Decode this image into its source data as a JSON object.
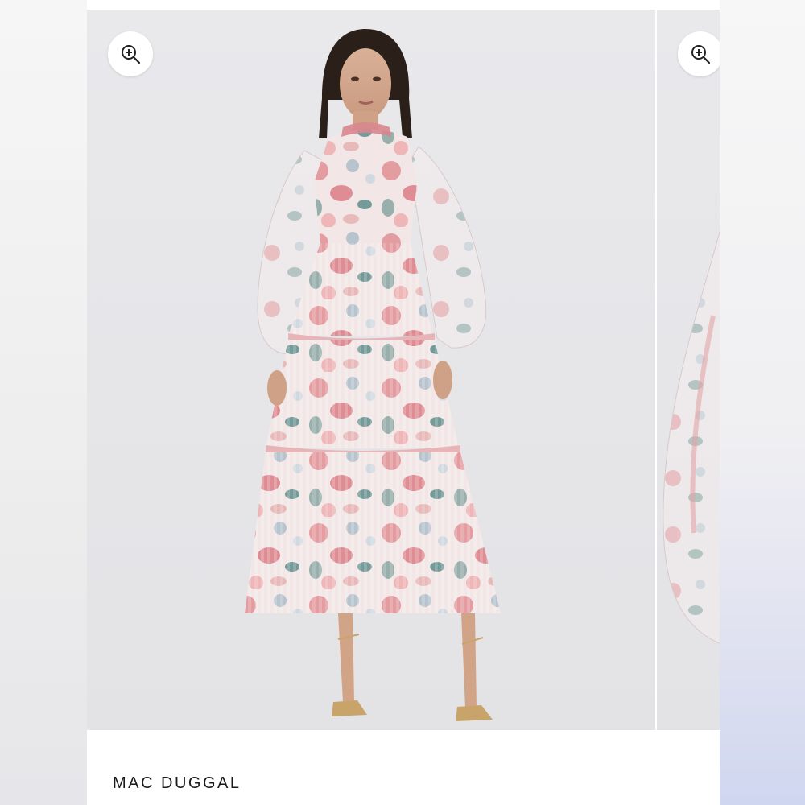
{
  "product": {
    "brand": "MAC DUGGAL"
  },
  "gallery": {
    "zoom_icon": "zoom-in-icon",
    "slides": [
      {
        "image": "model-floral-tulle-midi-dress-front"
      },
      {
        "image": "floral-tulle-sleeve-detail"
      }
    ]
  },
  "colors": {
    "background": "#e6e6e9",
    "dress_pink": "#e08b8f",
    "dress_teal": "#3f7b78",
    "brand_text": "#1a1a1a"
  }
}
